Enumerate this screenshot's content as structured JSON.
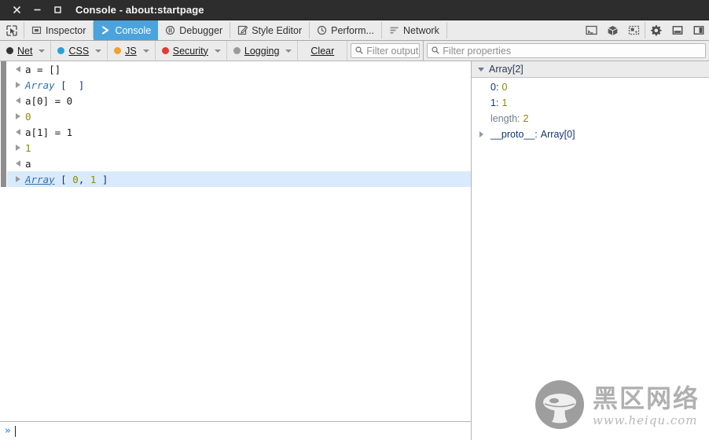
{
  "window": {
    "title": "Console - about:startpage",
    "buttons": [
      {
        "name": "close",
        "glyph": "✕"
      },
      {
        "name": "minimize",
        "glyph": "–"
      },
      {
        "name": "maximize",
        "glyph": "□"
      }
    ]
  },
  "toolbar": {
    "picker_icon": "element-picker-icon",
    "tabs": [
      {
        "label": "Inspector",
        "icon": "inspector-icon",
        "active": false
      },
      {
        "label": "Console",
        "icon": "console-chevron-icon",
        "active": true
      },
      {
        "label": "Debugger",
        "icon": "debugger-pause-icon",
        "active": false
      },
      {
        "label": "Style Editor",
        "icon": "style-editor-icon",
        "active": false
      },
      {
        "label": "Perform...",
        "icon": "performance-clock-icon",
        "active": false
      },
      {
        "label": "Network",
        "icon": "network-icon",
        "active": false
      }
    ],
    "tools": [
      {
        "name": "scratchpad-icon"
      },
      {
        "name": "3d-view-cube-icon"
      },
      {
        "name": "responsive-design-icon"
      },
      {
        "name": "settings-gear-icon"
      },
      {
        "name": "dock-bottom-icon"
      },
      {
        "name": "dock-side-icon"
      }
    ]
  },
  "filterbar": {
    "filters": [
      {
        "label": "Net",
        "color": "#333333"
      },
      {
        "label": "CSS",
        "color": "#2b9fd8"
      },
      {
        "label": "JS",
        "color": "#f0a030"
      },
      {
        "label": "Security",
        "color": "#e53935"
      },
      {
        "label": "Logging",
        "color": "#9a9a9a"
      }
    ],
    "clear_label": "Clear",
    "console_filter_placeholder": "Filter output",
    "properties_filter_placeholder": "Filter properties"
  },
  "console": {
    "rows": [
      {
        "kind": "input",
        "text": "a = []"
      },
      {
        "kind": "output",
        "parts": [
          {
            "t": "Array",
            "c": "obj"
          },
          {
            "t": " [  ]",
            "c": "brk"
          }
        ],
        "selected": false
      },
      {
        "kind": "input",
        "text": "a[0] = 0"
      },
      {
        "kind": "output",
        "parts": [
          {
            "t": "0",
            "c": "num"
          }
        ],
        "selected": false
      },
      {
        "kind": "input",
        "text": "a[1] = 1"
      },
      {
        "kind": "output",
        "parts": [
          {
            "t": "1",
            "c": "num"
          }
        ],
        "selected": false
      },
      {
        "kind": "input",
        "text": "a"
      },
      {
        "kind": "output",
        "parts": [
          {
            "t": "Array",
            "c": "obj-u"
          },
          {
            "t": " [ ",
            "c": "brk"
          },
          {
            "t": "0",
            "c": "num"
          },
          {
            "t": ", ",
            "c": "brk"
          },
          {
            "t": "1",
            "c": "num"
          },
          {
            "t": " ]",
            "c": "brk"
          }
        ],
        "selected": true
      }
    ],
    "prompt_glyph": "»",
    "prompt_value": ""
  },
  "sidebar": {
    "header": "Array[2]",
    "properties": [
      {
        "name": "0",
        "value": "0",
        "vclass": "num",
        "expandable": false,
        "dim": false
      },
      {
        "name": "1",
        "value": "1",
        "vclass": "num",
        "expandable": false,
        "dim": false
      },
      {
        "name": "length",
        "value": "2",
        "vclass": "num",
        "expandable": false,
        "dim": true
      },
      {
        "name": "__proto__",
        "value": "Array[0]",
        "vclass": "obj",
        "expandable": true,
        "dim": false
      }
    ]
  },
  "watermark": {
    "cn_text": "黑区网络",
    "url_text": "www.heiqu.com",
    "logo": "mushroom-logo-icon"
  }
}
